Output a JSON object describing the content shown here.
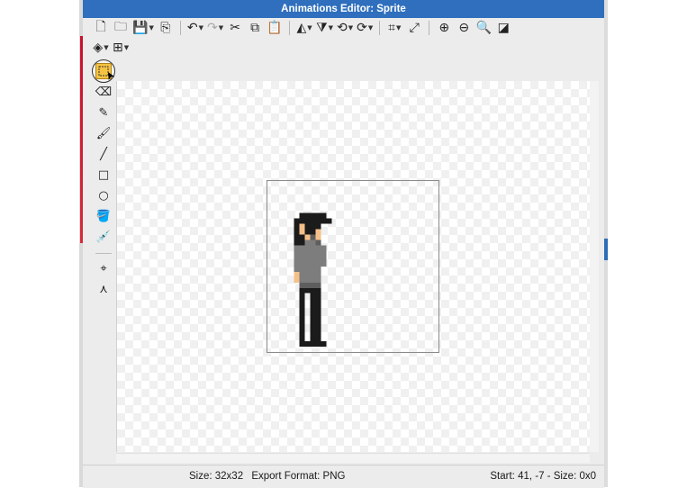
{
  "window": {
    "title": "Animations Editor: Sprite"
  },
  "toolbar": {
    "row1": [
      {
        "name": "new-document-icon",
        "glyph": "🗋"
      },
      {
        "name": "open-folder-icon",
        "glyph": "🗀"
      },
      {
        "name": "save-icon",
        "glyph": "💾",
        "caret": true
      },
      {
        "name": "import-icon",
        "glyph": "⎘"
      },
      {
        "sep": true
      },
      {
        "name": "undo-icon",
        "glyph": "↶",
        "caret": true
      },
      {
        "name": "redo-icon",
        "glyph": "↷",
        "caret": true,
        "disabled": true
      },
      {
        "name": "cut-icon",
        "glyph": "✂"
      },
      {
        "name": "copy-icon",
        "glyph": "⧉"
      },
      {
        "name": "paste-icon",
        "glyph": "📋"
      },
      {
        "sep": true
      },
      {
        "name": "flip-horizontal-icon",
        "glyph": "◭",
        "caret": true
      },
      {
        "name": "flip-vertical-icon",
        "glyph": "⧩",
        "caret": true
      },
      {
        "name": "rotate-left-icon",
        "glyph": "⟲",
        "caret": true
      },
      {
        "name": "rotate-right-icon",
        "glyph": "⟳",
        "caret": true
      },
      {
        "sep": true
      },
      {
        "name": "crop-icon",
        "glyph": "⌗",
        "caret": true
      },
      {
        "name": "resize-icon",
        "glyph": "⤢"
      },
      {
        "sep": true
      },
      {
        "name": "zoom-in-icon",
        "glyph": "⊕"
      },
      {
        "name": "zoom-out-icon",
        "glyph": "⊖"
      },
      {
        "name": "zoom-fit-icon",
        "glyph": "🔍"
      },
      {
        "name": "background-toggle-icon",
        "glyph": "◪"
      }
    ],
    "row2": [
      {
        "name": "layers-icon",
        "glyph": "◈",
        "caret": true
      },
      {
        "name": "grid-icon",
        "glyph": "⊞",
        "caret": true
      }
    ]
  },
  "tools": [
    {
      "name": "selection-tool-icon",
      "selected": true
    },
    {
      "name": "eraser-tool-icon",
      "glyph": "⌫"
    },
    {
      "name": "pencil-tool-icon",
      "glyph": "✎"
    },
    {
      "name": "brush-tool-icon",
      "glyph": "🖌"
    },
    {
      "name": "line-tool-icon",
      "glyph": "╱"
    },
    {
      "name": "rectangle-tool-icon",
      "glyph": "□"
    },
    {
      "name": "ellipse-tool-icon",
      "glyph": "○"
    },
    {
      "name": "fill-bucket-tool-icon",
      "glyph": "🪣"
    },
    {
      "name": "eyedropper-tool-icon",
      "glyph": "💉"
    },
    {
      "sep": true
    },
    {
      "name": "origin-point-tool-icon",
      "glyph": "⌖"
    },
    {
      "name": "collision-point-tool-icon",
      "glyph": "⋏"
    }
  ],
  "sprite": {
    "width": 32,
    "height": 32,
    "palette": {
      "k": "#1b1b1b",
      "g": "#7d7d7d",
      "d": "#5e5e5e",
      "s": "#f4c08a",
      "w": "#ffffff"
    }
  },
  "status": {
    "size": "Size: 32x32",
    "export_format": "Export Format: PNG",
    "cursor_info": "Start: 41, -7 - Size: 0x0"
  }
}
